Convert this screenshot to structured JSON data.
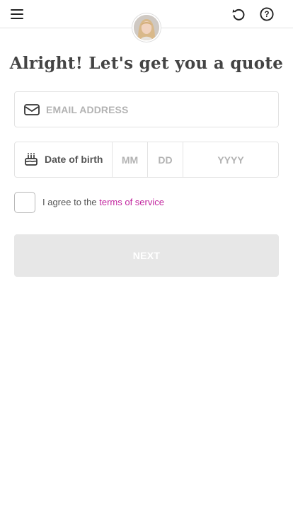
{
  "header": {
    "menu_icon": "hamburger-menu-icon",
    "reset_icon": "refresh-icon",
    "help_icon": "help-circle-icon",
    "help_glyph": "?"
  },
  "title": "Alright! Let's get you a quote",
  "email": {
    "placeholder": "EMAIL ADDRESS",
    "value": "",
    "icon": "envelope-icon"
  },
  "dob": {
    "label": "Date of birth",
    "icon": "cake-icon",
    "month_placeholder": "MM",
    "day_placeholder": "DD",
    "year_placeholder": "YYYY"
  },
  "terms": {
    "text": "I agree to the ",
    "link_text": "terms of service",
    "checked": false
  },
  "next_button": {
    "label": "NEXT",
    "enabled": false
  },
  "colors": {
    "accent": "#c2269f",
    "button_disabled_bg": "#e7e7e7",
    "border": "#e3e3e3"
  }
}
